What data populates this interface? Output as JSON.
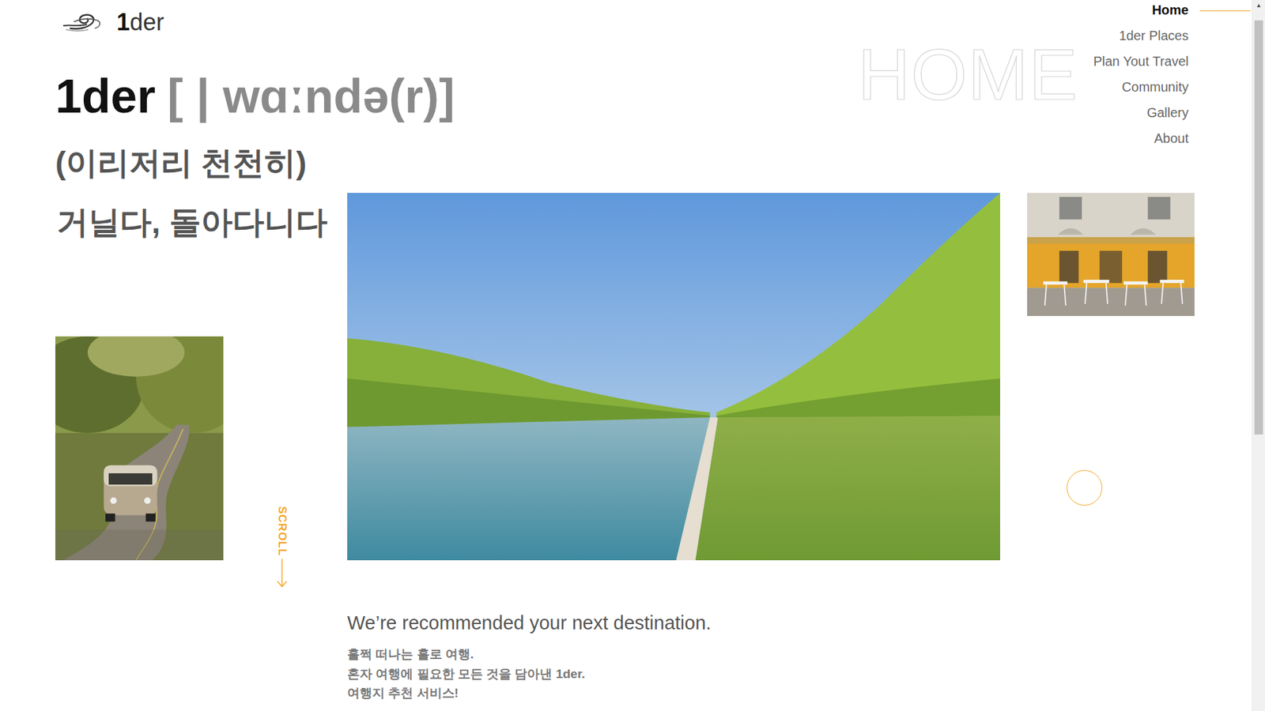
{
  "logo": {
    "text_bold": "1",
    "text_light": "der"
  },
  "nav": {
    "items": [
      {
        "label": "Home",
        "selected": true
      },
      {
        "label": "1der Places",
        "selected": false
      },
      {
        "label": "Plan Yout Travel",
        "selected": false
      },
      {
        "label": "Community",
        "selected": false
      },
      {
        "label": "Gallery",
        "selected": false
      },
      {
        "label": "About",
        "selected": false
      }
    ]
  },
  "watermark": "HOME",
  "hero": {
    "word": "1der",
    "pronunciation": "[ | wɑːndə(r)]",
    "meaning_1": "(이리저리 천천히)",
    "meaning_2": "거닐다, 돌아다니다"
  },
  "scroll_hint": {
    "label": "SCROLL"
  },
  "intro": {
    "heading": "We’re recommended your next destination.",
    "lines": [
      "훌쩍 떠나는 홀로 여행.",
      "혼자 여행에 필요한 모든 것을 담아낸 1der.",
      "여행지 추천 서비스!"
    ]
  },
  "scrollbar": {
    "up_arrow": "▲",
    "level": 0.6
  }
}
